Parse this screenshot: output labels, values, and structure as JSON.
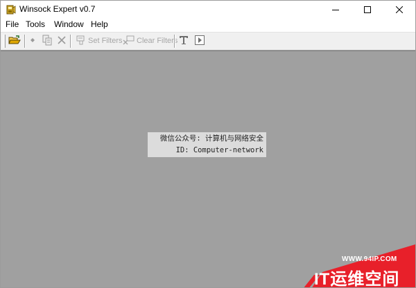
{
  "window": {
    "title": "Winsock Expert v0.7"
  },
  "menu": [
    "File",
    "Tools",
    "Window",
    "Help"
  ],
  "toolbar": {
    "set_filters": "Set Filters",
    "clear_filters": "Clear Filters"
  },
  "overlay": {
    "line1": "微信公众号: 计算机与网络安全",
    "line2": "ID: Computer-network"
  },
  "brand": {
    "url": "WWW.94IP.COM",
    "name": "IT运维空间"
  },
  "colors": {
    "client_bg": "#a0a0a0",
    "brand_red": "#e8202a"
  }
}
